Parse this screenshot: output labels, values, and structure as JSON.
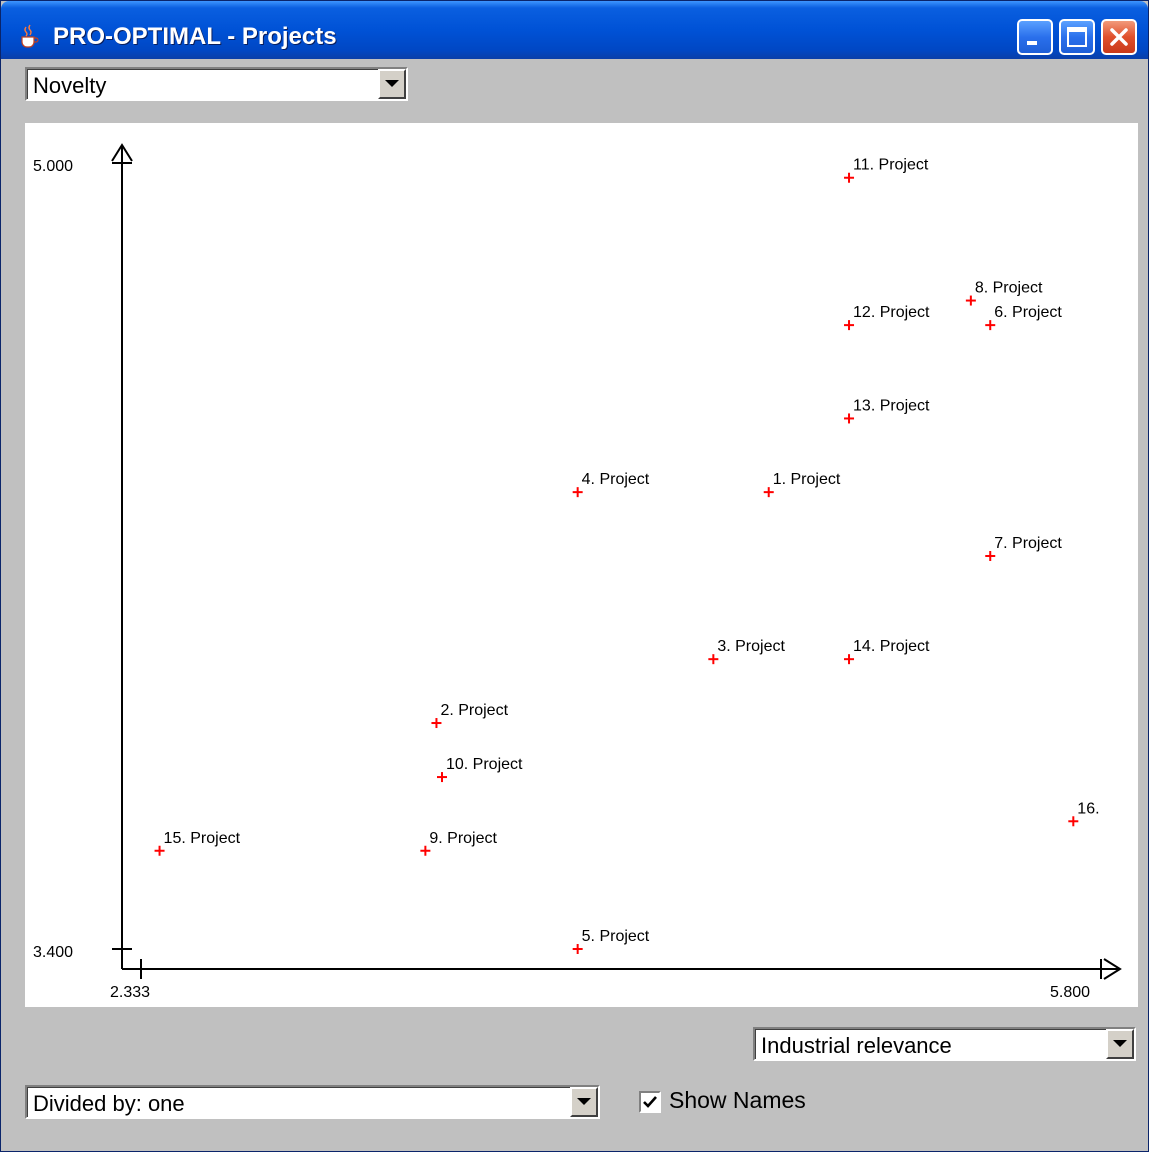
{
  "window": {
    "title": "PRO-OPTIMAL - Projects",
    "icon": "java-cup-icon",
    "controls": [
      "minimize-icon",
      "maximize-icon",
      "close-icon"
    ]
  },
  "y_selector": {
    "value": "Novelty"
  },
  "x_selector": {
    "value": "Industrial relevance"
  },
  "divisor_selector": {
    "value": "Divided by: one"
  },
  "show_names": {
    "label": "Show Names",
    "checked": true
  },
  "colors": {
    "point": "#ff0000",
    "axis": "#000000",
    "titlebar": "#0052d6"
  },
  "chart_data": {
    "type": "scatter",
    "xlim": [
      2.333,
      5.8
    ],
    "ylim": [
      3.4,
      5.0
    ],
    "x_tick_labels": [
      "2.333",
      "5.800"
    ],
    "y_tick_labels": [
      "5.000",
      "3.400"
    ],
    "points": [
      {
        "label": "1. Project",
        "x": 4.6,
        "y": 4.33
      },
      {
        "label": "2. Project",
        "x": 3.4,
        "y": 3.86
      },
      {
        "label": "3. Project",
        "x": 4.4,
        "y": 3.99
      },
      {
        "label": "4. Project",
        "x": 3.91,
        "y": 4.33
      },
      {
        "label": "5. Project",
        "x": 3.91,
        "y": 3.4
      },
      {
        "label": "6. Project",
        "x": 5.4,
        "y": 4.67
      },
      {
        "label": "7. Project",
        "x": 5.4,
        "y": 4.2
      },
      {
        "label": "8. Project",
        "x": 5.33,
        "y": 4.72
      },
      {
        "label": "9. Project",
        "x": 3.36,
        "y": 3.6
      },
      {
        "label": "10. Project",
        "x": 3.42,
        "y": 3.75
      },
      {
        "label": "11. Project",
        "x": 4.89,
        "y": 4.97
      },
      {
        "label": "12. Project",
        "x": 4.89,
        "y": 4.67
      },
      {
        "label": "13. Project",
        "x": 4.89,
        "y": 4.48
      },
      {
        "label": "14. Project",
        "x": 4.89,
        "y": 3.99
      },
      {
        "label": "15. Project",
        "x": 2.4,
        "y": 3.6
      },
      {
        "label": "16.",
        "x": 5.7,
        "y": 3.66
      }
    ]
  }
}
